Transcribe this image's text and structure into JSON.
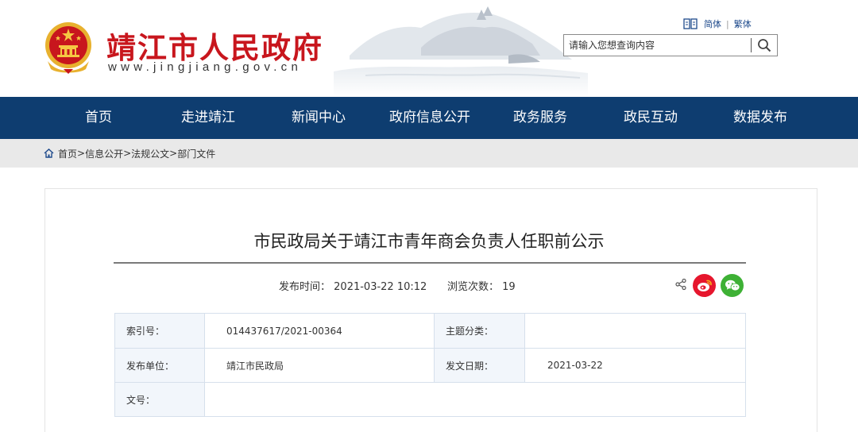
{
  "header": {
    "site_title": "靖江市人民政府",
    "site_url": "www.jingjiang.gov.cn",
    "lang_simplified": "简体",
    "lang_separator": "|",
    "lang_traditional": "繁体",
    "search_placeholder": "请输入您想查询内容",
    "emblem_color": "#c8161d",
    "icons": [
      "national-emblem",
      "book-icon",
      "search-icon"
    ]
  },
  "nav": {
    "items": [
      {
        "label": "首页"
      },
      {
        "label": "走进靖江"
      },
      {
        "label": "新闻中心"
      },
      {
        "label": "政府信息公开"
      },
      {
        "label": "政务服务"
      },
      {
        "label": "政民互动"
      },
      {
        "label": "数据发布"
      }
    ],
    "background": "#0e3d70"
  },
  "breadcrumb": {
    "items": [
      "首页",
      "信息公开",
      "法规公文",
      "部门文件"
    ],
    "separator": ">"
  },
  "article": {
    "title": "市民政局关于靖江市青年商会负责人任职前公示",
    "publish_label": "发布时间：",
    "publish_time": "2021-03-22 10:12",
    "views_label": "浏览次数：",
    "views": "19",
    "share_icons": [
      "share-icon",
      "weibo-icon",
      "wechat-icon"
    ]
  },
  "info_table": {
    "index_label": "索引号：",
    "index_value": "014437617/2021-00364",
    "topic_label": "主题分类：",
    "topic_value": "",
    "publisher_label": "发布单位：",
    "publisher_value": "靖江市民政局",
    "date_label": "发文日期：",
    "date_value": "2021-03-22",
    "docno_label": "文号："
  }
}
